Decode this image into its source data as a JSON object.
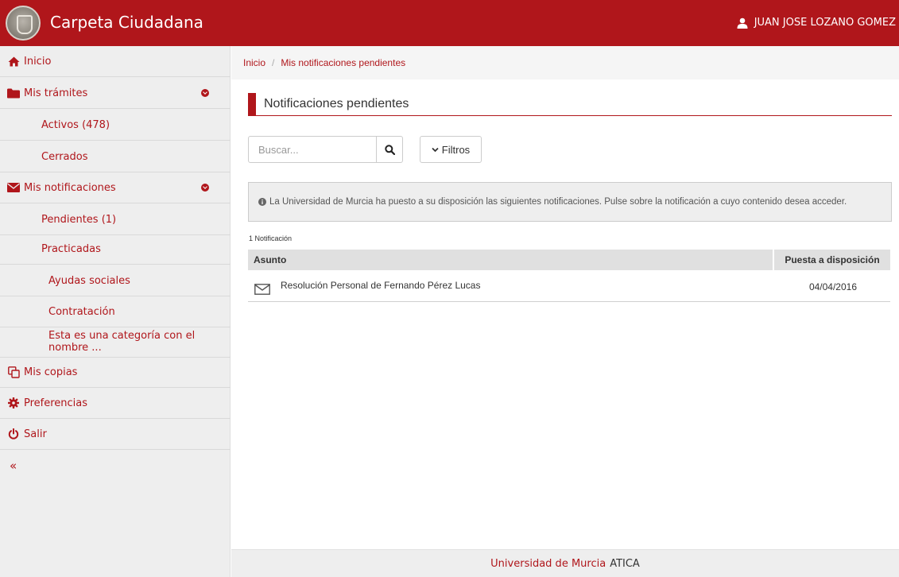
{
  "header": {
    "app_title": "Carpeta Ciudadana",
    "user_name": "JUAN JOSE LOZANO GOMEZ",
    "brand_color": "#b0161b"
  },
  "sidebar": {
    "inicio": "Inicio",
    "mis_tramites": "Mis trámites",
    "activos": "Activos (478)",
    "cerrados": "Cerrados",
    "mis_notificaciones": "Mis notificaciones",
    "pendientes": "Pendientes (1)",
    "practicadas": "Practicadas",
    "ayudas_sociales": "Ayudas sociales",
    "contratacion": "Contratación",
    "categoria_larga": "Esta es una categoría con el nombre ...",
    "mis_copias": "Mis copias",
    "preferencias": "Preferencias",
    "salir": "Salir",
    "collapse": "«"
  },
  "breadcrumb": {
    "home": "Inicio",
    "separator": "/",
    "current": "Mis notificaciones pendientes"
  },
  "main": {
    "title": "Notificaciones pendientes",
    "search_placeholder": "Buscar...",
    "filters_label": "Filtros",
    "info_text": "La Universidad de Murcia ha puesto a su disposición las siguientes notificaciones. Pulse sobre la notificación a cuyo contenido desea acceder.",
    "count_label": "1 Notificación",
    "columns": {
      "subject": "Asunto",
      "date": "Puesta a disposición"
    },
    "rows": [
      {
        "subject": "Resolución Personal de Fernando Pérez Lucas",
        "date": "04/04/2016"
      }
    ]
  },
  "footer": {
    "university": "Universidad de Murcia",
    "atica": "ATICA"
  }
}
